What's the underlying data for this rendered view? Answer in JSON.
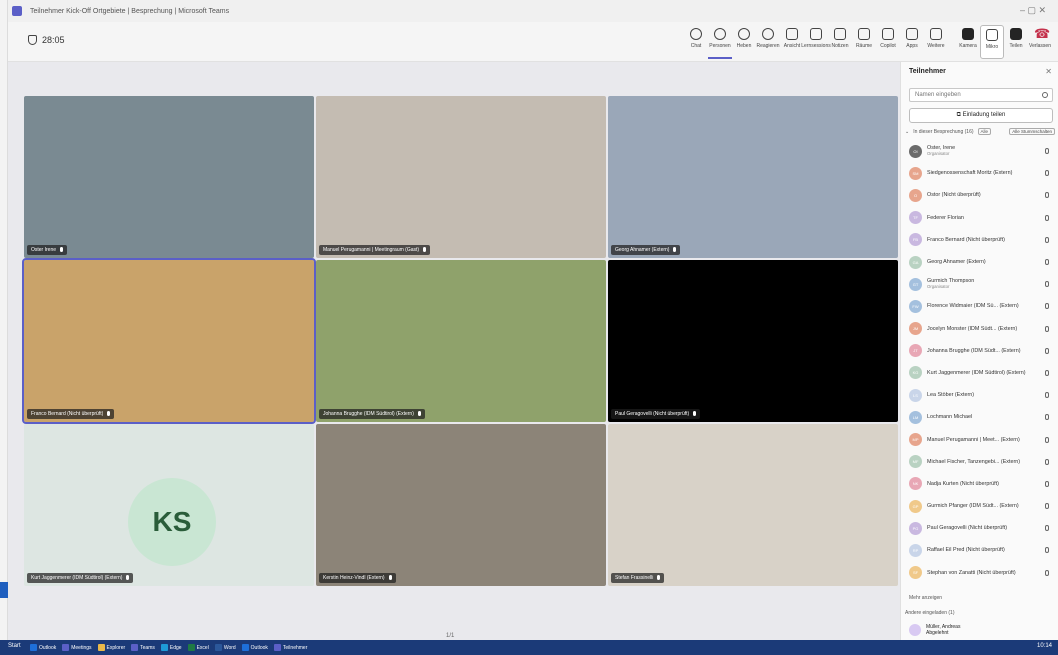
{
  "window": {
    "title": "Teilnehmer Kick-Off Ortgebiete | Besprechung | Microsoft Teams"
  },
  "toolbar": {
    "timer": "28:05",
    "tools": [
      {
        "label": "Chat",
        "icon": "chat-icon"
      },
      {
        "label": "Personen",
        "icon": "people-icon",
        "active": true
      },
      {
        "label": "Heben",
        "icon": "raise-hand-icon"
      },
      {
        "label": "Reagieren",
        "icon": "react-icon"
      },
      {
        "label": "Ansicht",
        "icon": "view-icon"
      },
      {
        "label": "Lernsessions",
        "icon": "rooms-icon"
      },
      {
        "label": "Notizen",
        "icon": "notes-icon"
      },
      {
        "label": "Räume",
        "icon": "breakout-icon"
      },
      {
        "label": "Copilot",
        "icon": "copilot-icon"
      },
      {
        "label": "Apps",
        "icon": "apps-icon"
      },
      {
        "label": "Weitere",
        "icon": "more-icon"
      },
      {
        "label": "Kamera",
        "icon": "camera-icon"
      },
      {
        "label": "Mikro",
        "icon": "mic-icon",
        "selected": true
      },
      {
        "label": "Teilen",
        "icon": "share-icon"
      },
      {
        "label": "Verlassen",
        "icon": "leave-icon"
      }
    ]
  },
  "tiles": [
    {
      "name": "Oster Irene",
      "bg": "#7a8a92",
      "desc": "Frau vor Bergpanorama"
    },
    {
      "name": "Manuel Perugamanni | Meetingraum (Gast)",
      "bg": "#c4bcb2",
      "desc": "Mann im Büro"
    },
    {
      "name": "Georg Ahnamer (Extern)",
      "bg": "#9aa7b8",
      "desc": "Mann mit Headset"
    },
    {
      "name": "Franco Bernard (Nicht überprüft)",
      "bg": "#c9a36a",
      "desc": "Mann lächelnd, Wüstenhintergrund",
      "selected": true
    },
    {
      "name": "Johanna Brugghe (IDM Südtirol) (Extern)",
      "bg": "#8fa26b",
      "desc": "Frau mit Headset, IDM-Hintergrund"
    },
    {
      "name": "Paul Geragovelli (Nicht überprüft)",
      "bg": "#000000",
      "desc": ""
    },
    {
      "name": "Kurt Jaggenmerer (IDM Südtirol) (Extern)",
      "bg": "#dde6e2",
      "avatar": "KS"
    },
    {
      "name": "Kerstin Heinz-Vindl (Extern)",
      "bg": "#8c8478",
      "desc": "Mann am Schreibtisch"
    },
    {
      "name": "Stefan Frassinelli",
      "bg": "#d8d2c8",
      "desc": "Mann vor Wand mit Bildern"
    }
  ],
  "pager": "1/1",
  "panel": {
    "title": "Teilnehmer",
    "search_placeholder": "Namen eingeben",
    "invite_label": "Einladung teilen",
    "section_label": "In dieser Besprechung (16)",
    "mute_all": "Alle",
    "manage": "Alle Stummschalten",
    "participants": [
      {
        "initials": "OI",
        "name": "Oster, Irene",
        "sub": "Organisator",
        "color": "#6b6b6b"
      },
      {
        "initials": "SM",
        "name": "Siedgenossenschaft Moritz (Extern)",
        "sub": "",
        "color": "#e7a58d"
      },
      {
        "initials": "O",
        "name": "Ostor (Nicht überprüft)",
        "sub": "",
        "color": "#e7a58d"
      },
      {
        "initials": "TF",
        "name": "Federer Florian",
        "sub": "",
        "color": "#c9b8e0"
      },
      {
        "initials": "FB",
        "name": "Franco Bernard (Nicht überprüft)",
        "sub": "",
        "color": "#c9b8e0"
      },
      {
        "initials": "GA",
        "name": "Georg Ahnamer (Extern)",
        "sub": "",
        "color": "#b9d2c2"
      },
      {
        "initials": "GT",
        "name": "Gurmich Thompson",
        "sub": "Organisator",
        "color": "#a4c0de"
      },
      {
        "initials": "FW",
        "name": "Florence Widmaier (IDM Sü... (Extern)",
        "sub": "",
        "color": "#a4c0de"
      },
      {
        "initials": "JM",
        "name": "Jocelyn Monster (IDM Südt... (Extern)",
        "sub": "",
        "color": "#e7a58d"
      },
      {
        "initials": "JT",
        "name": "Johanna Brugghe (IDM Südt... (Extern)",
        "sub": "",
        "color": "#e8a7b5"
      },
      {
        "initials": "KG",
        "name": "Kurt Jaggenmerer (IDM Südtirol) (Extern)",
        "sub": "",
        "color": "#b9d2c2"
      },
      {
        "initials": "LS",
        "name": "Lea Stöber (Extern)",
        "sub": "",
        "color": "#c9d5e9"
      },
      {
        "initials": "LM",
        "name": "Lochmann Michael",
        "sub": "",
        "color": "#a4c0de"
      },
      {
        "initials": "MP",
        "name": "Manuel Perugamanni | Meet... (Extern)",
        "sub": "",
        "color": "#e7a58d"
      },
      {
        "initials": "MF",
        "name": "Michael Fischer, Tanzengebi... (Extern)",
        "sub": "",
        "color": "#b9d2c2"
      },
      {
        "initials": "NK",
        "name": "Nadja Kurten (Nicht überprüft)",
        "sub": "",
        "color": "#e8a7b5"
      },
      {
        "initials": "GP",
        "name": "Gurmich Pfanger (IDM Südt... (Extern)",
        "sub": "",
        "color": "#f0c98a"
      },
      {
        "initials": "PG",
        "name": "Paul Geragovelli (Nicht überprüft)",
        "sub": "",
        "color": "#c9b8e0"
      },
      {
        "initials": "RP",
        "name": "Raffael Eil Pred (Nicht überprüft)",
        "sub": "",
        "color": "#c9d5e9"
      },
      {
        "initials": "SF",
        "name": "Stephan von Zanatti (Nicht überprüft)",
        "sub": "",
        "color": "#f0c98a"
      }
    ],
    "more_label": "Mehr anzeigen",
    "lobby_label": "Andere eingeladen (1)",
    "lobby_person": {
      "name": "Müller, Andreas",
      "sub": "Abgelehnt"
    }
  },
  "taskbar": {
    "start": "Start",
    "items": [
      {
        "label": "Outlook",
        "color": "#1e6fd9"
      },
      {
        "label": "Meetings",
        "color": "#5b5fc7"
      },
      {
        "label": "Explorer",
        "color": "#e8b84a"
      },
      {
        "label": "Teams",
        "color": "#5b5fc7"
      },
      {
        "label": "Edge",
        "color": "#1e9bd7"
      },
      {
        "label": "Excel",
        "color": "#1f7a45"
      },
      {
        "label": "Word",
        "color": "#2b579a"
      },
      {
        "label": "Outlook",
        "color": "#1e6fd9"
      },
      {
        "label": "Teilnehmer",
        "color": "#5b5fc7"
      }
    ],
    "clock": "10:14"
  }
}
